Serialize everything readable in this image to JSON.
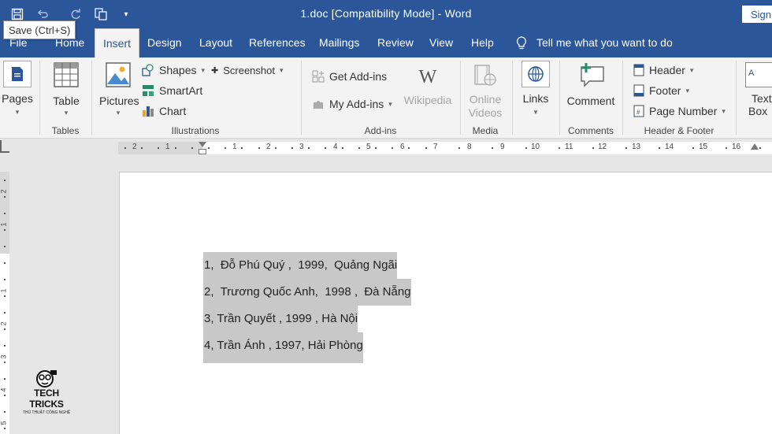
{
  "titlebar": {
    "title": "1.doc [Compatibility Mode]  -  Word",
    "signin": "Sign",
    "tooltip": "Save (Ctrl+S)",
    "qa_icons": [
      "save-icon",
      "undo-icon",
      "redo-icon",
      "touch-mode-icon",
      "customize-qat-icon"
    ]
  },
  "tabs": [
    "File",
    "Home",
    "Insert",
    "Design",
    "Layout",
    "References",
    "Mailings",
    "Review",
    "View",
    "Help"
  ],
  "active_tab": "Insert",
  "tell_me": "Tell me what you want to do",
  "ribbon": {
    "pages": {
      "label": "Pages"
    },
    "tables": {
      "button": "Table",
      "group": "Tables"
    },
    "illustrations": {
      "pictures": "Pictures",
      "shapes": "Shapes",
      "smartart": "SmartArt",
      "chart": "Chart",
      "screenshot": "Screenshot",
      "group": "Illustrations"
    },
    "addins": {
      "get": "Get Add-ins",
      "my": "My Add-ins",
      "wikipedia": "Wikipedia",
      "group": "Add-ins"
    },
    "media": {
      "online1": "Online",
      "online2": "Videos",
      "group": "Media"
    },
    "links": {
      "label": "Links"
    },
    "comments": {
      "label": "Comment",
      "group": "Comments"
    },
    "header_footer": {
      "header": "Header",
      "footer": "Footer",
      "page_number": "Page Number",
      "group": "Header & Footer"
    },
    "textbox": {
      "line1": "Text",
      "line2": "Box"
    }
  },
  "ruler": {
    "labels": [
      "2",
      "1",
      "1",
      "2",
      "3",
      "4",
      "5",
      "6",
      "7",
      "8",
      "9",
      "10",
      "11",
      "12",
      "13",
      "14",
      "15",
      "16"
    ],
    "vertical_labels": [
      "2",
      "1",
      "1",
      "2",
      "3",
      "4",
      "5"
    ]
  },
  "document": {
    "lines": [
      "1,  Đỗ Phú Quý ,  1999,  Quảng Ngãi",
      "2,  Trương Quốc Anh,  1998 ,  Đà Nẵng",
      "3, Trần Quyết , 1999 , Hà Nội",
      "4, Trần Ánh , 1997, Hải Phòng"
    ]
  },
  "watermark": {
    "title": "TECH TRICKS",
    "subtitle": "THỦ THUẬT CÔNG NGHỆ"
  },
  "colors": {
    "accent": "#2b579a",
    "selection": "#c8c8c8",
    "ribbon_bg": "#f3f3f3"
  }
}
